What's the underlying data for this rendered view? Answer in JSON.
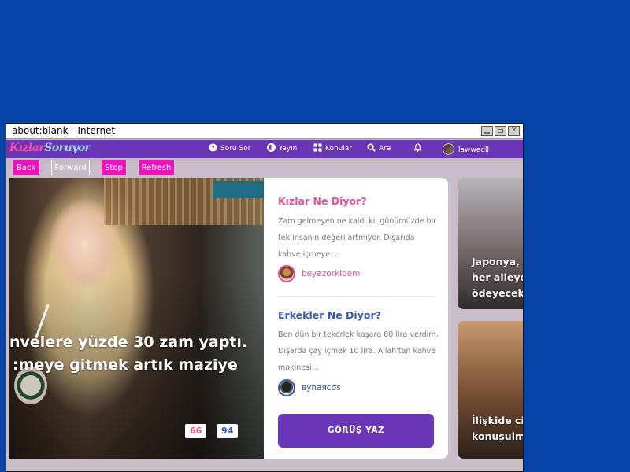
{
  "window": {
    "title": "about:blank - Internet"
  },
  "site": {
    "logo_a": "Kızlar",
    "logo_b": "Soruyor",
    "nav": {
      "soru_sor": "Soru Sor",
      "yayin": "Yayın",
      "konular": "Konular",
      "ara": "Ara",
      "username": "lawwedll"
    }
  },
  "toolbar": {
    "back": "Back",
    "forward": "Forward",
    "stop": "Stop",
    "refresh": "Refresh"
  },
  "hero": {
    "headline_1": "nvelere yüzde 30 zam yaptı.",
    "headline_2": ":meye gitmek artık maziye",
    "count_k": "66",
    "count_e": "94"
  },
  "card": {
    "kizlar_title": "Kızlar Ne Diyor?",
    "kizlar_text": "Zam gelmeyen ne kaldı ki, günümüzde bir tek insanın değeri artmıyor. Dışarıda kahve içmeye...",
    "kizlar_author": "beyazorkidem",
    "erkekler_title": "Erkekler Ne Diyor?",
    "erkekler_text": "Ben dün bir tekerlek kaşara 80 lira verdim. Dışarda çay içmek 10 lira. Allah'tan kahve makinesi...",
    "erkekler_author": "вуnаяcσѕ",
    "cta": "GÖRÜŞ YAZ"
  },
  "side": {
    "s1_line1": "Japonya, ",
    "s1_line2": "her aileye",
    "s1_line3": "ödeyecek",
    "s2_line1": "İlişkide ci",
    "s2_line2": "konuşulm"
  },
  "colors": {
    "desktop": "#0543a8",
    "brand_purple": "#6a35b7",
    "toolbar_pink": "#f012bd",
    "girls_pink": "#ec4f8e",
    "boys_blue": "#3559b5"
  }
}
